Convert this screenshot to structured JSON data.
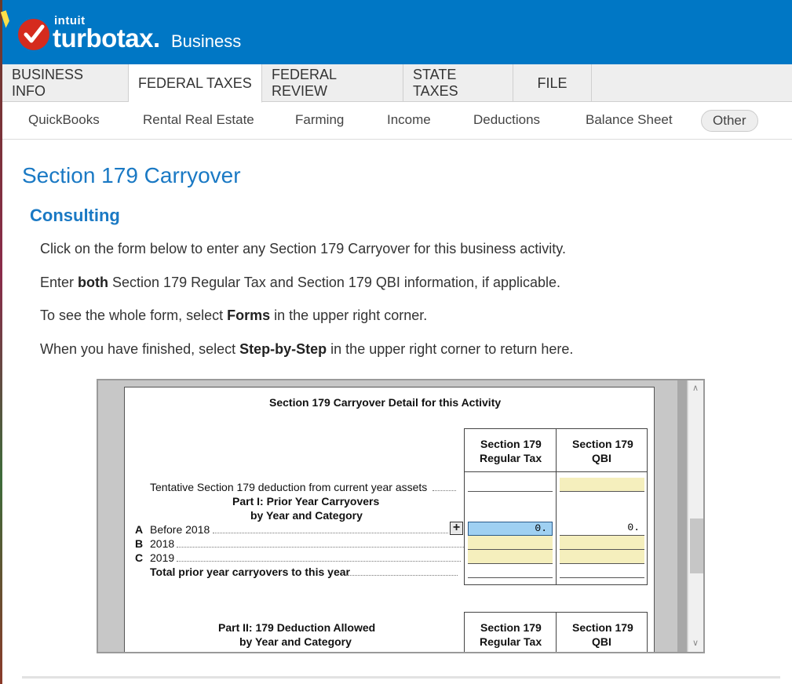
{
  "brand": {
    "intuit": "intuit",
    "product": "turbotax.",
    "edition": "Business",
    "check_color": "#d52b1e",
    "header_color": "#0077c5"
  },
  "tabs": [
    {
      "label": "BUSINESS INFO",
      "active": false
    },
    {
      "label": "FEDERAL TAXES",
      "active": true
    },
    {
      "label": "FEDERAL REVIEW",
      "active": false
    },
    {
      "label": "STATE TAXES",
      "active": false
    },
    {
      "label": "FILE",
      "active": false
    }
  ],
  "subnav": [
    {
      "label": "QuickBooks"
    },
    {
      "label": "Rental Real Estate"
    },
    {
      "label": "Farming"
    },
    {
      "label": "Income"
    },
    {
      "label": "Deductions"
    },
    {
      "label": "Balance Sheet"
    },
    {
      "label": "Other",
      "selected": true
    }
  ],
  "page": {
    "title": "Section 179 Carryover",
    "subtitle": "Consulting",
    "para1": "Click on the form below to enter any Section 179 Carryover for this business activity.",
    "para2": {
      "pre": "Enter ",
      "bold": "both",
      "post": " Section 179 Regular Tax and Section 179 QBI information, if applicable."
    },
    "para3": {
      "pre": "To see the whole form, select ",
      "bold": "Forms",
      "post": " in the upper right corner."
    },
    "para4": {
      "pre": "When you have finished, select ",
      "bold": "Step-by-Step",
      "post": " in the upper right corner to return here."
    }
  },
  "form": {
    "heading": "Section 179 Carryover Detail for this Activity",
    "col1_header_line1": "Section 179",
    "col1_header_line2": "Regular Tax",
    "col2_header_line1": "Section 179",
    "col2_header_line2": "QBI",
    "tentative": "Tentative Section 179 deduction from current year assets",
    "part1_line1": "Part I: Prior Year Carryovers",
    "part1_line2": "by Year and Category",
    "rows": [
      {
        "letter": "A",
        "label": "Before 2018",
        "regular": "0.",
        "qbi": "0."
      },
      {
        "letter": "B",
        "label": "2018",
        "regular": "",
        "qbi": ""
      },
      {
        "letter": "C",
        "label": "2019",
        "regular": "",
        "qbi": ""
      }
    ],
    "total": "Total prior year carryovers to this year",
    "part2_line1": "Part II: 179 Deduction Allowed",
    "part2_line2": "by Year and Category",
    "col3_header_line1": "Section 179",
    "col3_header_line2": "Regular Tax",
    "col4_header_line1": "Section 179",
    "col4_header_line2": "QBI"
  }
}
